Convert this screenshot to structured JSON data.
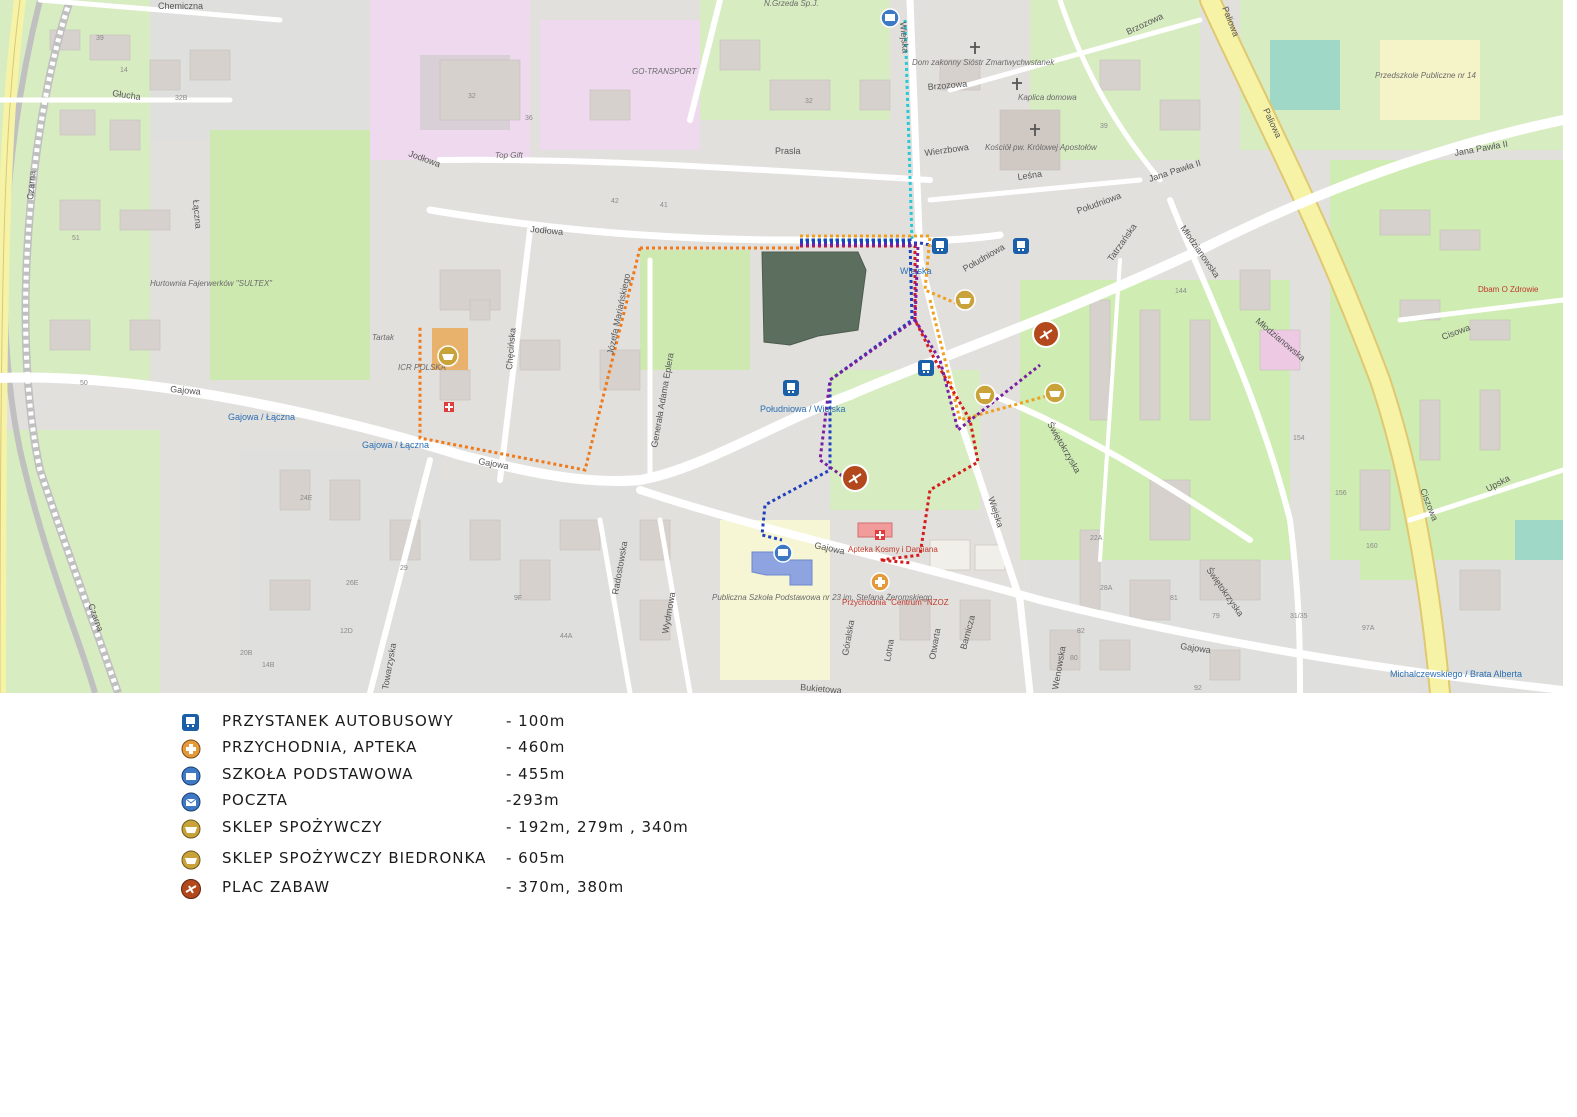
{
  "map": {
    "streets": {
      "chemiczna": "Chemiczna",
      "glucha": "Głucha",
      "jodlowa": "Jodłowa",
      "jodlowa2": "Jodłowa",
      "gajowa": "Gajowa",
      "gajowa2": "Gajowa",
      "gajowa3": "Gajowa",
      "gajowa4": "Gajowa",
      "prasla": "Prasla",
      "wierzbowa": "Wierzbowa",
      "lesna": "Leśna",
      "brzozowa": "Brzozowa",
      "brzozowa2": "Brzozowa",
      "jana_pawla": "Jana Pawła II",
      "jana_pawla2": "Jana Pawła II",
      "poludniowa": "Południowa",
      "poludniowa2": "Południowa",
      "wiejska": "Wiejska",
      "wiejska2": "Wiejska",
      "swietokrzyska": "Świętokrzyska",
      "swietokrzyska2": "Świętokrzyska",
      "tatrzanska": "Tatrzańska",
      "mlodzianowska": "Młodzianowska",
      "mlodzianowska2": "Młodzianowska",
      "radostowska": "Radostowska",
      "wydmowa": "Wydmowa",
      "goralska": "Góralska",
      "lotna": "Lotna",
      "otwarta": "Otwarta",
      "barnicza": "Barnicza",
      "wenowska": "Wenowska",
      "bukietowa": "Bukietowa",
      "czarna": "Czarna",
      "czarna2": "Czarna",
      "lakowa": "Łączna",
      "towarzyska": "Towarzyska",
      "chechinska": "Chęcińska",
      "sandomierska": "Józefa Mariańskiego",
      "eplera": "Generała Adama Eplera",
      "ciszowa": "Ciszowa",
      "cisowa": "Cisowa",
      "upska": "Upska",
      "paliowa": "Paliowa",
      "paliowa2": "Paliowa"
    },
    "places": {
      "dom_zakonny": "Dom zakonny Sióstr Zmartwychwstanek",
      "kaplica": "Kaplica domowa",
      "kosciol": "Kościół pw. Królowej Apostołów",
      "przedszkole": "Przedszkole Publiczne nr 14",
      "dbam": "Dbam O Zdrowie",
      "hurtownia": "Hurtownia Fajerwerków \"SULTEX\"",
      "tartak": "Tartak",
      "icr_polska": "ICR POLSKA",
      "go_transport": "GO-TRANSPORT",
      "top_gift": "Top Gift",
      "n_grzeda": "N.Grzeda Sp.J.",
      "szkola": "Publiczna Szkoła Podstawowa nr 23 im. Stefana Żeromskiego",
      "apteka": "Apteka Kosmy i Damiana",
      "przychodnia": "Przychodnia \"Centrum\" NZOZ",
      "stop_gajowa_laczna": "Gajowa / Łączna",
      "stop_gajowa_laczna2": "Gajowa / Łączna",
      "stop_poludniowa_wiejska": "Południowa / Wiejska",
      "stop_wiejska": "Wiejska",
      "stop_michalczewskiego": "Michalczewskiego / Brata Alberta"
    }
  },
  "legend": [
    {
      "icon": "bus-stop-icon",
      "label": "PRZYSTANEK AUTOBUSOWY",
      "distance": "- 100m"
    },
    {
      "icon": "clinic-pharmacy-icon",
      "label": "PRZYCHODNIA, APTEKA",
      "distance": "- 460m"
    },
    {
      "icon": "primary-school-icon",
      "label": "SZKOŁA PODSTAWOWA",
      "distance": "- 455m"
    },
    {
      "icon": "post-office-icon",
      "label": "POCZTA",
      "distance": "-293m"
    },
    {
      "icon": "grocery-store-icon",
      "label": "SKLEP SPOŻYWCZY",
      "distance": "- 192m, 279m , 340m"
    },
    {
      "icon": "biedronka-store-icon",
      "label": "SKLEP SPOŻYWCZY BIEDRONKA",
      "distance": "- 605m"
    },
    {
      "icon": "playground-icon",
      "label": "PLAC ZABAW",
      "distance": "- 370m, 380m"
    }
  ],
  "colors": {
    "route_bus": "#1f3fbf",
    "route_clinic": "#d41c1c",
    "route_school": "#1f3fbf",
    "route_post": "#27c9d6",
    "route_grocery": "#f0a020",
    "route_biedronka": "#f07a1a",
    "route_playground": "#7a1fa0",
    "plot": "#5c6f5e",
    "residential": "#e0dfdf",
    "industrial": "#f2dff0",
    "grass": "#cfecb2",
    "road": "#ffffff",
    "trunk": "#f6f3a6"
  }
}
